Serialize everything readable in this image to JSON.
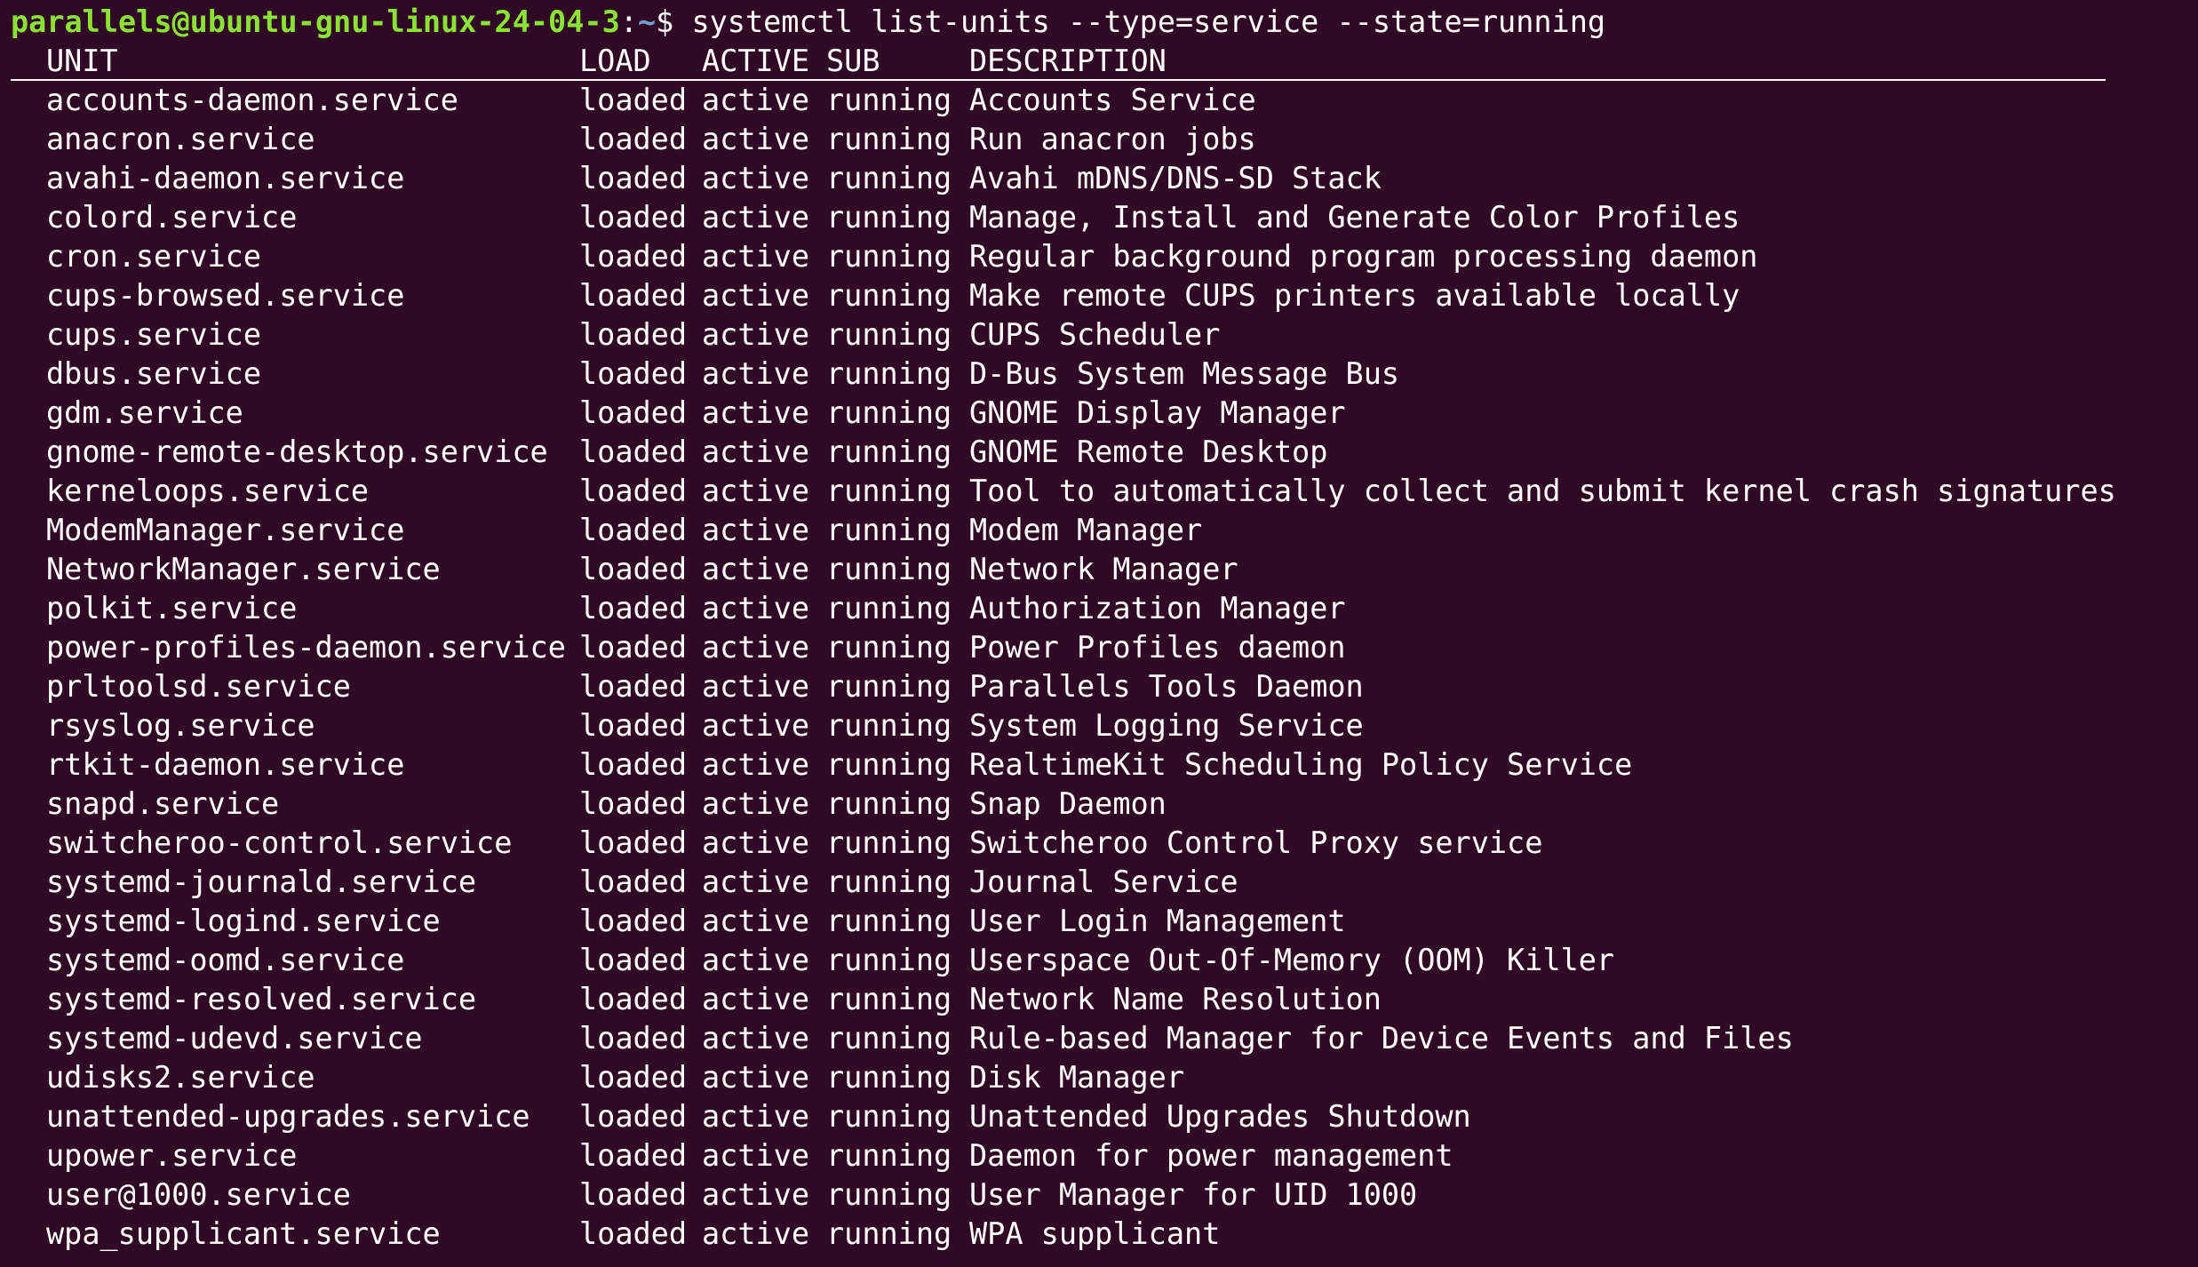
{
  "prompt": {
    "user_host": "parallels@ubuntu-gnu-linux-24-04-3",
    "separator": ":",
    "path": "~",
    "symbol": "$ ",
    "command": "systemctl list-units --type=service --state=running"
  },
  "columns": {
    "unit": "UNIT",
    "load": "LOAD",
    "active": "ACTIVE",
    "sub": "SUB",
    "description": "DESCRIPTION"
  },
  "rows": [
    {
      "unit": "accounts-daemon.service",
      "load": "loaded",
      "active": "active",
      "sub": "running",
      "description": "Accounts Service"
    },
    {
      "unit": "anacron.service",
      "load": "loaded",
      "active": "active",
      "sub": "running",
      "description": "Run anacron jobs"
    },
    {
      "unit": "avahi-daemon.service",
      "load": "loaded",
      "active": "active",
      "sub": "running",
      "description": "Avahi mDNS/DNS-SD Stack"
    },
    {
      "unit": "colord.service",
      "load": "loaded",
      "active": "active",
      "sub": "running",
      "description": "Manage, Install and Generate Color Profiles"
    },
    {
      "unit": "cron.service",
      "load": "loaded",
      "active": "active",
      "sub": "running",
      "description": "Regular background program processing daemon"
    },
    {
      "unit": "cups-browsed.service",
      "load": "loaded",
      "active": "active",
      "sub": "running",
      "description": "Make remote CUPS printers available locally"
    },
    {
      "unit": "cups.service",
      "load": "loaded",
      "active": "active",
      "sub": "running",
      "description": "CUPS Scheduler"
    },
    {
      "unit": "dbus.service",
      "load": "loaded",
      "active": "active",
      "sub": "running",
      "description": "D-Bus System Message Bus"
    },
    {
      "unit": "gdm.service",
      "load": "loaded",
      "active": "active",
      "sub": "running",
      "description": "GNOME Display Manager"
    },
    {
      "unit": "gnome-remote-desktop.service",
      "load": "loaded",
      "active": "active",
      "sub": "running",
      "description": "GNOME Remote Desktop"
    },
    {
      "unit": "kerneloops.service",
      "load": "loaded",
      "active": "active",
      "sub": "running",
      "description": "Tool to automatically collect and submit kernel crash signatures"
    },
    {
      "unit": "ModemManager.service",
      "load": "loaded",
      "active": "active",
      "sub": "running",
      "description": "Modem Manager"
    },
    {
      "unit": "NetworkManager.service",
      "load": "loaded",
      "active": "active",
      "sub": "running",
      "description": "Network Manager"
    },
    {
      "unit": "polkit.service",
      "load": "loaded",
      "active": "active",
      "sub": "running",
      "description": "Authorization Manager"
    },
    {
      "unit": "power-profiles-daemon.service",
      "load": "loaded",
      "active": "active",
      "sub": "running",
      "description": "Power Profiles daemon"
    },
    {
      "unit": "prltoolsd.service",
      "load": "loaded",
      "active": "active",
      "sub": "running",
      "description": "Parallels Tools Daemon"
    },
    {
      "unit": "rsyslog.service",
      "load": "loaded",
      "active": "active",
      "sub": "running",
      "description": "System Logging Service"
    },
    {
      "unit": "rtkit-daemon.service",
      "load": "loaded",
      "active": "active",
      "sub": "running",
      "description": "RealtimeKit Scheduling Policy Service"
    },
    {
      "unit": "snapd.service",
      "load": "loaded",
      "active": "active",
      "sub": "running",
      "description": "Snap Daemon"
    },
    {
      "unit": "switcheroo-control.service",
      "load": "loaded",
      "active": "active",
      "sub": "running",
      "description": "Switcheroo Control Proxy service"
    },
    {
      "unit": "systemd-journald.service",
      "load": "loaded",
      "active": "active",
      "sub": "running",
      "description": "Journal Service"
    },
    {
      "unit": "systemd-logind.service",
      "load": "loaded",
      "active": "active",
      "sub": "running",
      "description": "User Login Management"
    },
    {
      "unit": "systemd-oomd.service",
      "load": "loaded",
      "active": "active",
      "sub": "running",
      "description": "Userspace Out-Of-Memory (OOM) Killer"
    },
    {
      "unit": "systemd-resolved.service",
      "load": "loaded",
      "active": "active",
      "sub": "running",
      "description": "Network Name Resolution"
    },
    {
      "unit": "systemd-udevd.service",
      "load": "loaded",
      "active": "active",
      "sub": "running",
      "description": "Rule-based Manager for Device Events and Files"
    },
    {
      "unit": "udisks2.service",
      "load": "loaded",
      "active": "active",
      "sub": "running",
      "description": "Disk Manager"
    },
    {
      "unit": "unattended-upgrades.service",
      "load": "loaded",
      "active": "active",
      "sub": "running",
      "description": "Unattended Upgrades Shutdown"
    },
    {
      "unit": "upower.service",
      "load": "loaded",
      "active": "active",
      "sub": "running",
      "description": "Daemon for power management"
    },
    {
      "unit": "user@1000.service",
      "load": "loaded",
      "active": "active",
      "sub": "running",
      "description": "User Manager for UID 1000"
    },
    {
      "unit": "wpa_supplicant.service",
      "load": "loaded",
      "active": "active",
      "sub": "running",
      "description": "WPA supplicant"
    }
  ],
  "colors": {
    "background": "#300a24",
    "text": "#ffffff",
    "prompt_user": "#8ae234",
    "prompt_path": "#729fcf"
  }
}
